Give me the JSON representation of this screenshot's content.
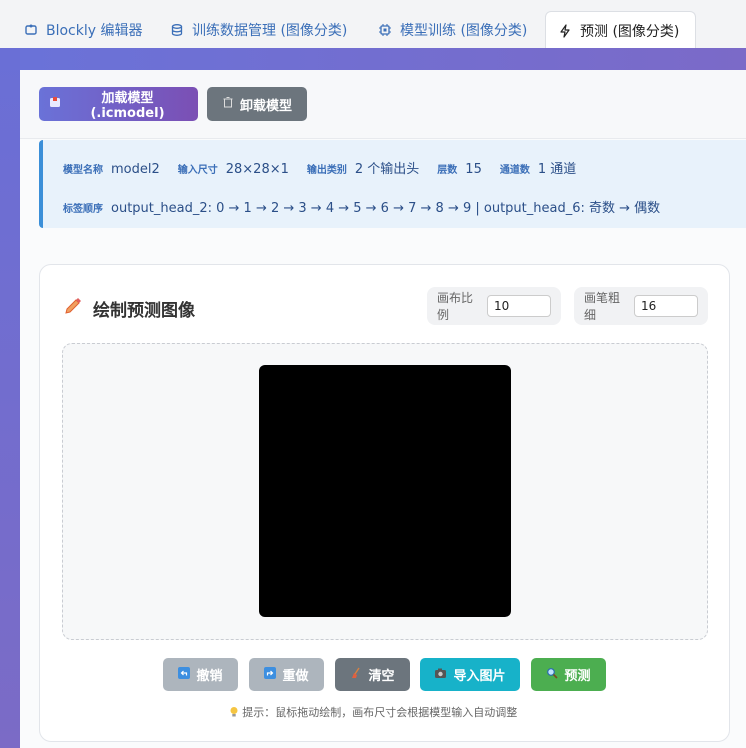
{
  "tabs": [
    {
      "label": "Blockly 编辑器",
      "icon": "puzzle-icon"
    },
    {
      "label": "训练数据管理 (图像分类)",
      "icon": "database-icon"
    },
    {
      "label": "模型训练 (图像分类)",
      "icon": "chip-icon"
    },
    {
      "label": "预测 (图像分类)",
      "icon": "lightning-icon",
      "active": true
    }
  ],
  "actions": {
    "load_label": "加载模型 (.icmodel)",
    "unload_label": "卸载模型"
  },
  "model_info": {
    "name_key": "模型名称",
    "name_val": "model2",
    "input_key": "输入尺寸",
    "input_val": "28×28×1",
    "classes_key": "输出类别",
    "classes_val": "2 个输出头",
    "layers_key": "层数",
    "layers_val": "15",
    "channels_key": "通道数",
    "channels_val": "1 通道",
    "order_key": "标签顺序",
    "order_val": "output_head_2: 0 → 1 → 2 → 3 → 4 → 5 → 6 → 7 → 8 → 9 | output_head_6: 奇数 → 偶数"
  },
  "draw": {
    "title": "绘制预测图像",
    "scale_label": "画布比例",
    "scale_value": "10",
    "brush_label": "画笔粗细",
    "brush_value": "16"
  },
  "canvas_actions": {
    "undo": "撤销",
    "redo": "重做",
    "clear": "清空",
    "import": "导入图片",
    "predict": "预测"
  },
  "hint": "提示：鼠标拖动绘制，画布尺寸会根据模型输入自动调整",
  "colors": {
    "accent": "#6a72d8",
    "info_border": "#3b8fd8",
    "import_btn": "#17b2c9",
    "predict_btn": "#4cae50"
  }
}
